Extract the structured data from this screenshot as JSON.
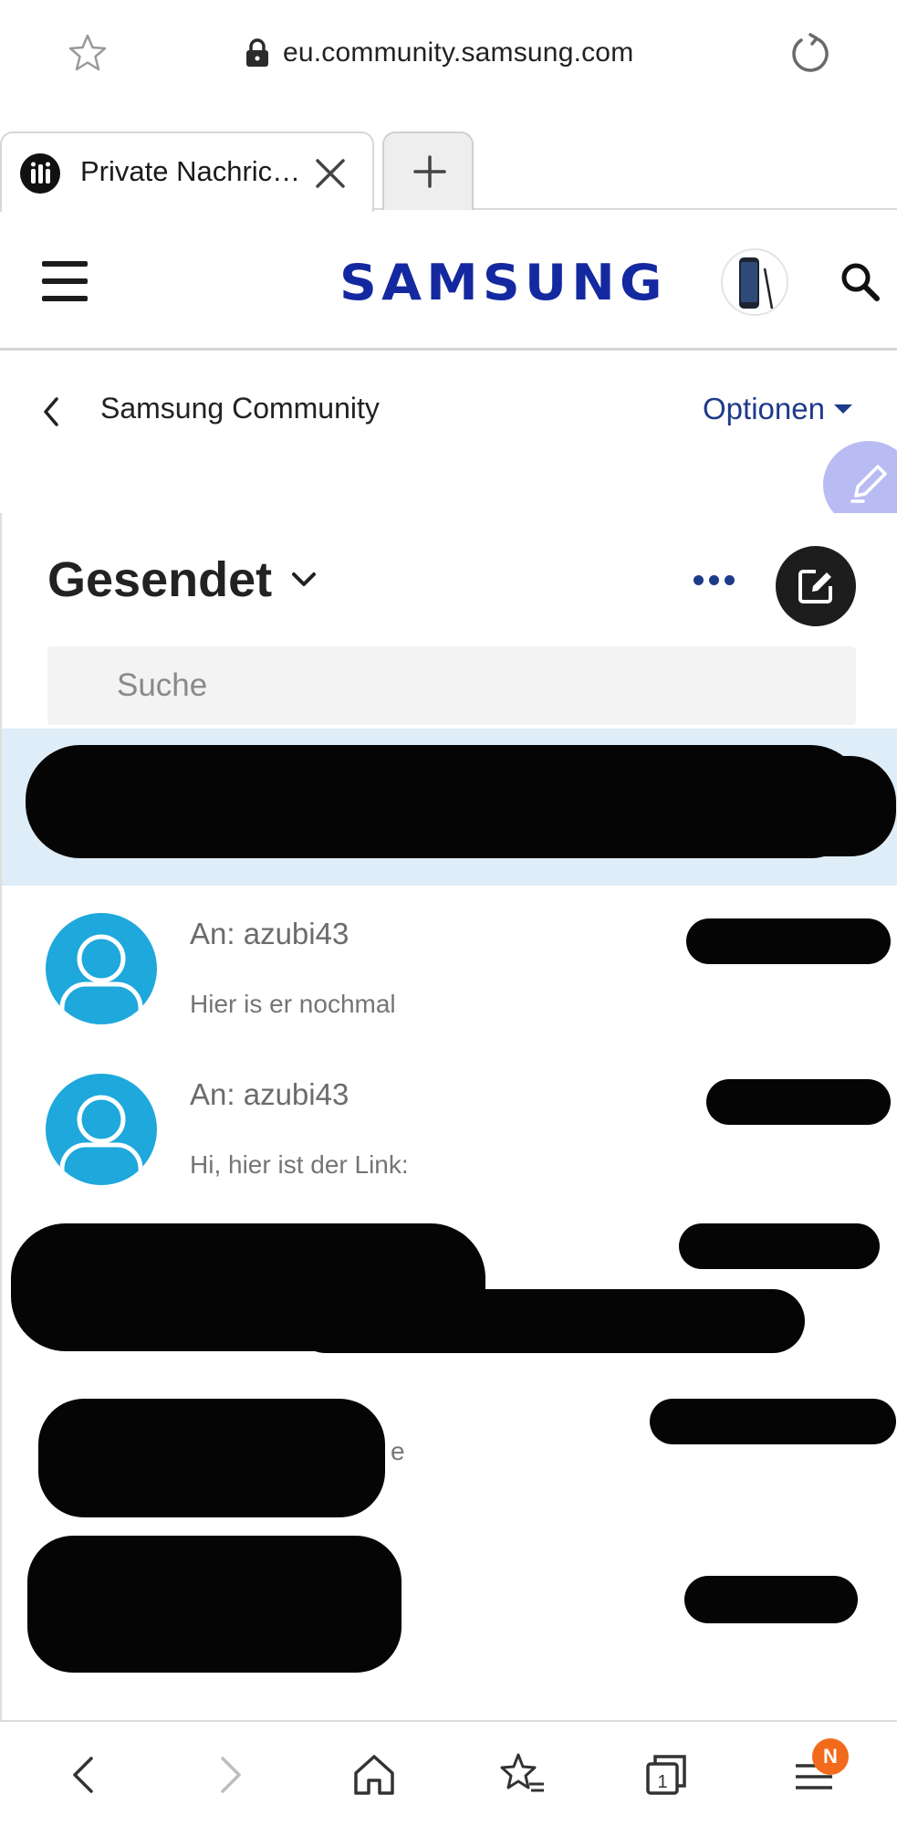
{
  "browser": {
    "url": "eu.community.samsung.com",
    "tabs": [
      {
        "title": "Private Nachric…",
        "active": true
      }
    ],
    "notification_badge": "N"
  },
  "header": {
    "brand": "SAMSUNG",
    "brand_color": "#1428a0"
  },
  "breadcrumb": {
    "label": "Samsung Community",
    "options_label": "Optionen"
  },
  "inbox": {
    "folder_title": "Gesendet",
    "search_placeholder": "Suche",
    "messages": [
      {
        "to_label": "An:",
        "recipient": "azubi43",
        "preview": "Hier is er nochmal"
      },
      {
        "to_label": "An:",
        "recipient": "azubi43",
        "preview": "Hi, hier ist der Link:"
      }
    ],
    "partially_visible_text": "e"
  },
  "colors": {
    "accent": "#1e3a8a",
    "highlight_row": "#deedf7",
    "avatar": "#1ea8dc",
    "badge": "#f26b1d"
  }
}
